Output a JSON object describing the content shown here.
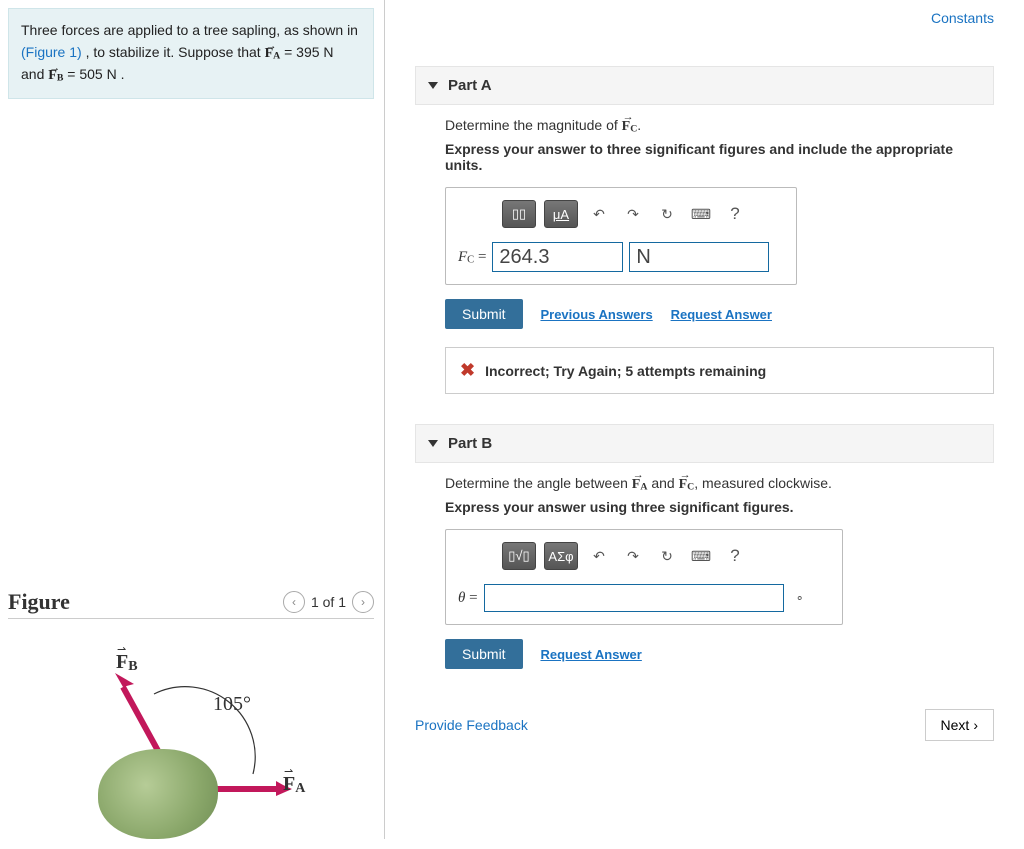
{
  "top_links": {
    "constants": "Constants"
  },
  "problem": {
    "line1_a": "Three forces are applied to a tree sapling, as shown in",
    "figref": "(Figure 1)",
    "line1_b": " , to stabilize it. Suppose that ",
    "fa_label": "F",
    "fa_sub": "A",
    "fa_val": " = 395  N",
    "line2_a": "and ",
    "fb_label": "F",
    "fb_sub": "B",
    "fb_val": " = 505  N ."
  },
  "figure_nav": {
    "title": "Figure",
    "counter": "1 of 1"
  },
  "figure": {
    "fb_label": "F",
    "fb_sub": "B",
    "angle_label": "105°",
    "fa_label": "F",
    "fa_sub": "A"
  },
  "partA": {
    "header": "Part A",
    "prompt_a": "Determine the magnitude of ",
    "fc_label": "F",
    "fc_sub": "C",
    "prompt_b": ".",
    "instr": "Express your answer to three significant figures and include the appropriate units.",
    "toolbar": {
      "t1": "▯▯",
      "t2": "μA",
      "t3": "↶",
      "t4": "↷",
      "t5": "↻",
      "t6": "⌨",
      "t7": "?"
    },
    "label": "F",
    "label_sub": "C",
    "eq": " = ",
    "value": "264.3",
    "unit": "N",
    "submit": "Submit",
    "prev_answers": "Previous Answers",
    "req_answer": "Request Answer",
    "feedback": "Incorrect; Try Again; 5 attempts remaining"
  },
  "partB": {
    "header": "Part B",
    "prompt_a": "Determine the angle between ",
    "fa_label": "F",
    "fa_sub": "A",
    "prompt_mid": " and ",
    "fc_label": "F",
    "fc_sub": "C",
    "prompt_b": ", measured clockwise.",
    "instr": "Express your answer using three significant figures.",
    "toolbar": {
      "t1": "▯√▯",
      "t2": "ΑΣφ",
      "t3": "↶",
      "t4": "↷",
      "t5": "↻",
      "t6": "⌨",
      "t7": "?"
    },
    "label": "θ",
    "eq": " = ",
    "value": "",
    "unit": "∘",
    "submit": "Submit",
    "req_answer": "Request Answer"
  },
  "footer": {
    "provide_feedback": "Provide Feedback",
    "next": "Next"
  }
}
